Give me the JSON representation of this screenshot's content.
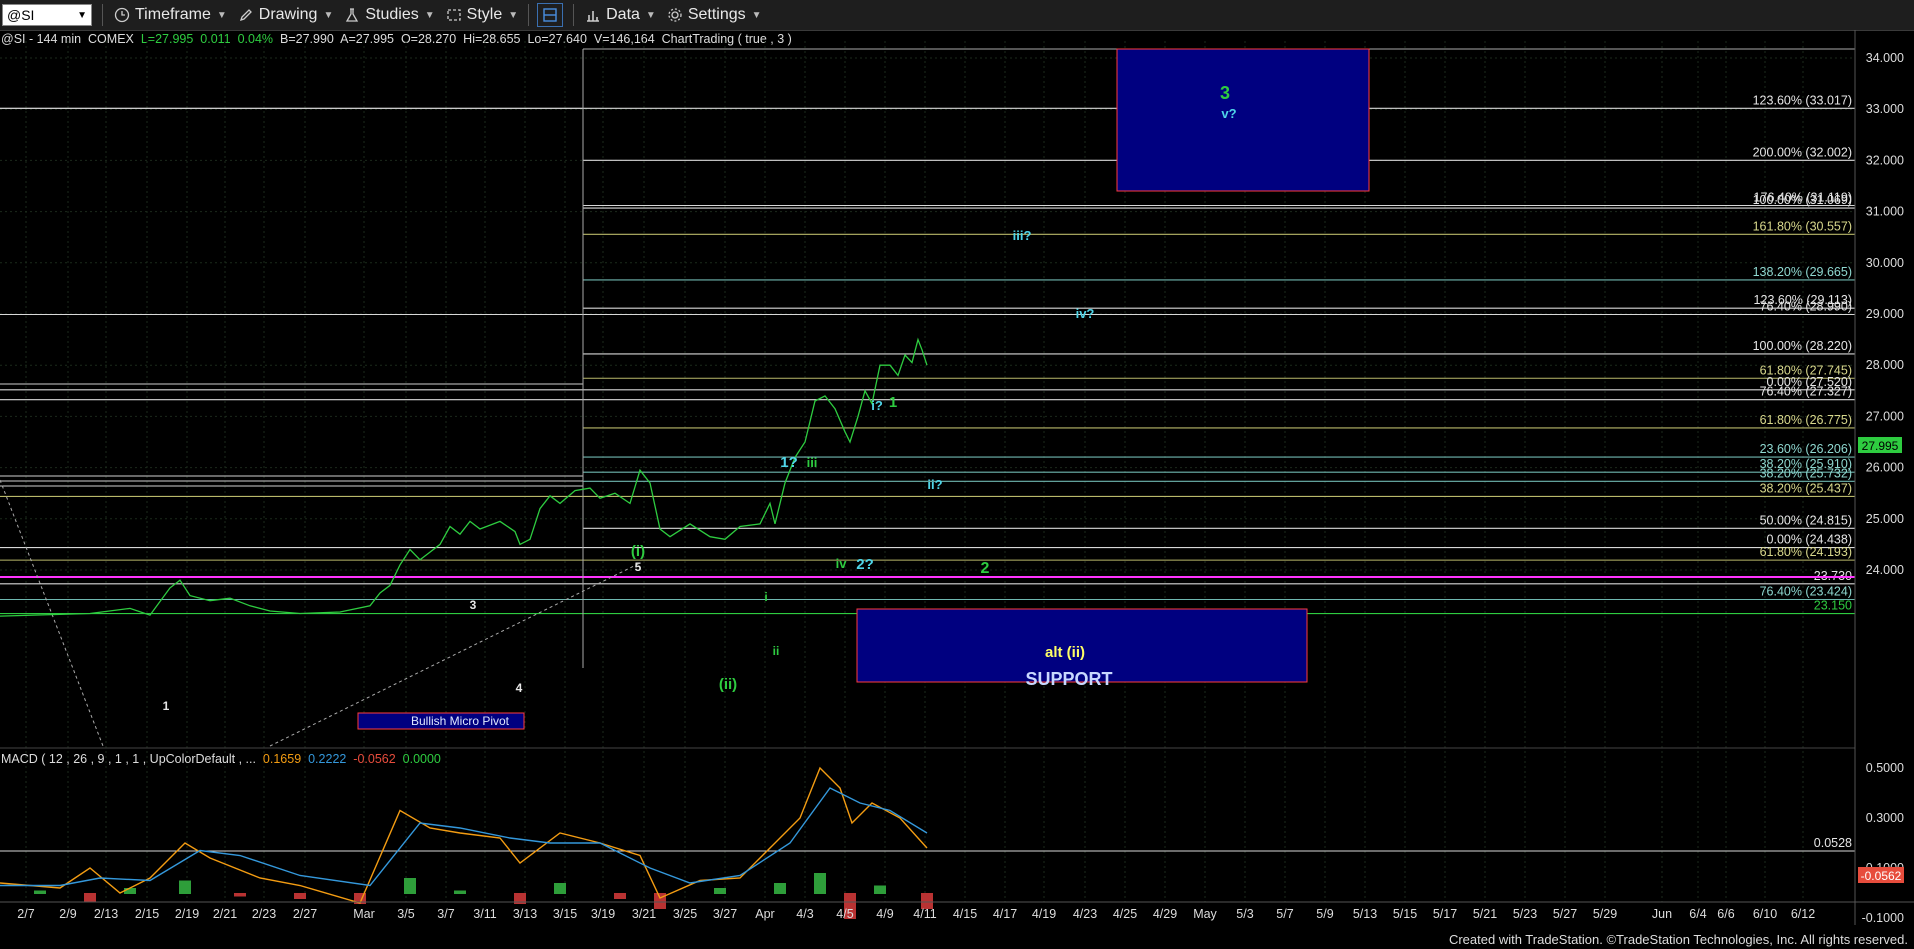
{
  "toolbar": {
    "symbol": "@SI",
    "timeframe": "Timeframe",
    "drawing": "Drawing",
    "studies": "Studies",
    "style": "Style",
    "data": "Data",
    "settings": "Settings"
  },
  "info": {
    "symbol": "@SI - 144 min",
    "exchange": "COMEX",
    "last": "L=27.995",
    "change": "0.011",
    "pct": "0.04%",
    "bid": "B=27.990",
    "ask": "A=27.995",
    "open": "O=28.270",
    "high": "Hi=28.655",
    "low": "Lo=27.640",
    "volume": "V=146,164",
    "chart_trading": "ChartTrading ( true , 3 )"
  },
  "macd": {
    "label": "MACD ( 12 , 26 , 9 , 1 , 1 , UpColorDefault , ...",
    "v1": "0.1659",
    "v2": "0.2222",
    "v3": "-0.0562",
    "v4": "0.0000"
  },
  "colors": {
    "price": "#2ecc40",
    "fib_white": "#e6e6e6",
    "fib_olive": "#c8c87a",
    "fib_teal": "#7fc8c0",
    "magenta": "#ff33ff",
    "box_fill": "#000080",
    "box_border": "#ff3b3b",
    "cyan": "#4fd5e8",
    "yellow": "#ffff66"
  },
  "chart_data": {
    "type": "line",
    "price_axis": {
      "min": 23.15,
      "max": 34.4,
      "ticks": [
        "34.000",
        "33.000",
        "32.000",
        "31.000",
        "30.000",
        "29.000",
        "28.000",
        "27.000",
        "26.000",
        "25.000",
        "24.000"
      ]
    },
    "last_price": "27.995",
    "fib_levels": [
      {
        "label": "123.60% (33.017)",
        "value": 33.017,
        "color": "white"
      },
      {
        "label": "200.00% (32.002)",
        "value": 32.002,
        "color": "white"
      },
      {
        "label": "176.40% (31.119)",
        "value": 31.119,
        "color": "white"
      },
      {
        "label": "100.00% (31.069)",
        "value": 31.069,
        "color": "white"
      },
      {
        "label": "161.80% (30.557)",
        "value": 30.557,
        "color": "olive"
      },
      {
        "label": "138.20% (29.665)",
        "value": 29.665,
        "color": "teal"
      },
      {
        "label": "123.60% (29.113)",
        "value": 29.113,
        "color": "white"
      },
      {
        "label": "76.40% (28.990)",
        "value": 28.99,
        "color": "white"
      },
      {
        "label": "100.00% (28.220)",
        "value": 28.22,
        "color": "white"
      },
      {
        "label": "61.80% (27.745)",
        "value": 27.745,
        "color": "olive"
      },
      {
        "label": "0.00% (27.520)",
        "value": 27.52,
        "color": "white"
      },
      {
        "label": "76.40% (27.327)",
        "value": 27.327,
        "color": "white"
      },
      {
        "label": "61.80% (26.775)",
        "value": 26.775,
        "color": "olive"
      },
      {
        "label": "23.60% (26.206)",
        "value": 26.206,
        "color": "teal"
      },
      {
        "label": "38.20% (25.910)",
        "value": 25.91,
        "color": "teal"
      },
      {
        "label": "38.20% (25.732)",
        "value": 25.732,
        "color": "teal"
      },
      {
        "label": "38.20% (25.437)",
        "value": 25.437,
        "color": "olive"
      },
      {
        "label": "50.00% (24.815)",
        "value": 24.815,
        "color": "white"
      },
      {
        "label": "0.00% (24.438)",
        "value": 24.438,
        "color": "white"
      },
      {
        "label": "61.80% (24.193)",
        "value": 24.193,
        "color": "olive"
      },
      {
        "label": "23.730",
        "value": 23.73,
        "color": "white"
      },
      {
        "label": "76.40% (23.424)",
        "value": 23.424,
        "color": "teal"
      },
      {
        "label": "23.150",
        "value": 23.15,
        "color": "green"
      }
    ],
    "wave_labels": [
      {
        "text": "3",
        "color": "green"
      },
      {
        "text": "v?",
        "color": "cyan"
      },
      {
        "text": "iii?",
        "color": "cyan"
      },
      {
        "text": "iv?",
        "color": "cyan"
      },
      {
        "text": "i?",
        "color": "cyan"
      },
      {
        "text": "1",
        "color": "green"
      },
      {
        "text": "1?",
        "color": "cyan"
      },
      {
        "text": "iii",
        "color": "green"
      },
      {
        "text": "ii?",
        "color": "cyan"
      },
      {
        "text": "iv",
        "color": "green"
      },
      {
        "text": "2?",
        "color": "cyan"
      },
      {
        "text": "2",
        "color": "green"
      },
      {
        "text": "(i)",
        "color": "green"
      },
      {
        "text": "5",
        "color": "white"
      },
      {
        "text": "(ii)",
        "color": "green"
      },
      {
        "text": "i",
        "color": "green"
      },
      {
        "text": "ii",
        "color": "green"
      },
      {
        "text": "3",
        "color": "white"
      },
      {
        "text": "4",
        "color": "white"
      },
      {
        "text": "1",
        "color": "white"
      }
    ],
    "boxes": {
      "support_title": "alt (ii)",
      "support_sub": "SUPPORT",
      "pivot": "Bullish Micro Pivot"
    },
    "macd_axis": {
      "ticks": [
        "0.5000",
        "0.3000",
        "0.1000",
        "-0.1000"
      ],
      "level": "0.0528",
      "last": "-0.0562"
    },
    "x_ticks": [
      "2/7",
      "2/9",
      "2/13",
      "2/15",
      "2/19",
      "2/21",
      "2/23",
      "2/27",
      "Mar",
      "3/5",
      "3/7",
      "3/11",
      "3/13",
      "3/15",
      "3/19",
      "3/21",
      "3/25",
      "3/27",
      "Apr",
      "4/3",
      "4/5",
      "4/9",
      "4/11",
      "4/15",
      "4/17",
      "4/19",
      "4/23",
      "4/25",
      "4/29",
      "May",
      "5/3",
      "5/7",
      "5/9",
      "5/13",
      "5/15",
      "5/17",
      "5/21",
      "5/23",
      "5/27",
      "5/29",
      "Jun",
      "6/4",
      "6/6",
      "6/10",
      "6/12"
    ],
    "price_series": [
      [
        0,
        23.1
      ],
      [
        90,
        23.15
      ],
      [
        130,
        23.25
      ],
      [
        150,
        23.12
      ],
      [
        170,
        23.65
      ],
      [
        180,
        23.8
      ],
      [
        190,
        23.5
      ],
      [
        210,
        23.4
      ],
      [
        230,
        23.45
      ],
      [
        250,
        23.3
      ],
      [
        270,
        23.2
      ],
      [
        300,
        23.15
      ],
      [
        340,
        23.18
      ],
      [
        370,
        23.3
      ],
      [
        380,
        23.55
      ],
      [
        390,
        23.7
      ],
      [
        400,
        24.1
      ],
      [
        410,
        24.4
      ],
      [
        420,
        24.2
      ],
      [
        430,
        24.35
      ],
      [
        440,
        24.5
      ],
      [
        450,
        24.85
      ],
      [
        460,
        24.7
      ],
      [
        470,
        24.95
      ],
      [
        480,
        24.8
      ],
      [
        500,
        24.95
      ],
      [
        515,
        24.75
      ],
      [
        520,
        24.5
      ],
      [
        530,
        24.6
      ],
      [
        540,
        25.2
      ],
      [
        550,
        25.45
      ],
      [
        560,
        25.3
      ],
      [
        575,
        25.55
      ],
      [
        590,
        25.6
      ],
      [
        600,
        25.4
      ],
      [
        615,
        25.5
      ],
      [
        630,
        25.3
      ],
      [
        640,
        25.95
      ],
      [
        650,
        25.7
      ],
      [
        660,
        24.8
      ],
      [
        670,
        24.65
      ],
      [
        690,
        24.9
      ],
      [
        710,
        24.65
      ],
      [
        725,
        24.6
      ],
      [
        740,
        24.85
      ],
      [
        760,
        24.9
      ],
      [
        770,
        25.3
      ],
      [
        775,
        24.9
      ],
      [
        785,
        25.7
      ],
      [
        795,
        26.2
      ],
      [
        805,
        26.5
      ],
      [
        815,
        27.3
      ],
      [
        825,
        27.4
      ],
      [
        835,
        27.15
      ],
      [
        845,
        26.7
      ],
      [
        850,
        26.5
      ],
      [
        858,
        27.0
      ],
      [
        865,
        27.5
      ],
      [
        872,
        27.25
      ],
      [
        880,
        28.0
      ],
      [
        890,
        28.0
      ],
      [
        898,
        27.8
      ],
      [
        905,
        28.2
      ],
      [
        912,
        28.05
      ],
      [
        918,
        28.5
      ],
      [
        922,
        28.3
      ],
      [
        927,
        28.0
      ]
    ],
    "macd_series": {
      "macd": [
        [
          0,
          0.04
        ],
        [
          60,
          0.02
        ],
        [
          90,
          0.1
        ],
        [
          120,
          0.0
        ],
        [
          150,
          0.06
        ],
        [
          185,
          0.2
        ],
        [
          210,
          0.14
        ],
        [
          260,
          0.06
        ],
        [
          300,
          0.03
        ],
        [
          360,
          -0.04
        ],
        [
          400,
          0.33
        ],
        [
          430,
          0.26
        ],
        [
          460,
          0.24
        ],
        [
          500,
          0.22
        ],
        [
          520,
          0.12
        ],
        [
          560,
          0.24
        ],
        [
          600,
          0.2
        ],
        [
          640,
          0.15
        ],
        [
          660,
          -0.02
        ],
        [
          700,
          0.05
        ],
        [
          740,
          0.06
        ],
        [
          780,
          0.22
        ],
        [
          800,
          0.3
        ],
        [
          820,
          0.5
        ],
        [
          840,
          0.42
        ],
        [
          852,
          0.28
        ],
        [
          872,
          0.36
        ],
        [
          900,
          0.3
        ],
        [
          927,
          0.18
        ]
      ],
      "signal": [
        [
          0,
          0.03
        ],
        [
          60,
          0.03
        ],
        [
          100,
          0.06
        ],
        [
          150,
          0.05
        ],
        [
          200,
          0.17
        ],
        [
          240,
          0.15
        ],
        [
          300,
          0.07
        ],
        [
          370,
          0.03
        ],
        [
          420,
          0.28
        ],
        [
          460,
          0.26
        ],
        [
          510,
          0.22
        ],
        [
          550,
          0.2
        ],
        [
          600,
          0.2
        ],
        [
          650,
          0.1
        ],
        [
          690,
          0.04
        ],
        [
          740,
          0.07
        ],
        [
          790,
          0.2
        ],
        [
          830,
          0.42
        ],
        [
          860,
          0.36
        ],
        [
          890,
          0.33
        ],
        [
          927,
          0.24
        ]
      ],
      "hist": [
        [
          40,
          0.01
        ],
        [
          90,
          -0.03
        ],
        [
          130,
          0.02
        ],
        [
          185,
          0.05
        ],
        [
          240,
          -0.01
        ],
        [
          300,
          -0.02
        ],
        [
          360,
          -0.04
        ],
        [
          410,
          0.06
        ],
        [
          460,
          0.01
        ],
        [
          520,
          -0.04
        ],
        [
          560,
          0.04
        ],
        [
          620,
          -0.02
        ],
        [
          660,
          -0.06
        ],
        [
          720,
          0.02
        ],
        [
          780,
          0.04
        ],
        [
          820,
          0.08
        ],
        [
          850,
          -0.1
        ],
        [
          880,
          0.03
        ],
        [
          927,
          -0.06
        ]
      ]
    }
  },
  "footer": "Created with TradeStation. ©TradeStation Technologies, Inc. All rights reserved."
}
